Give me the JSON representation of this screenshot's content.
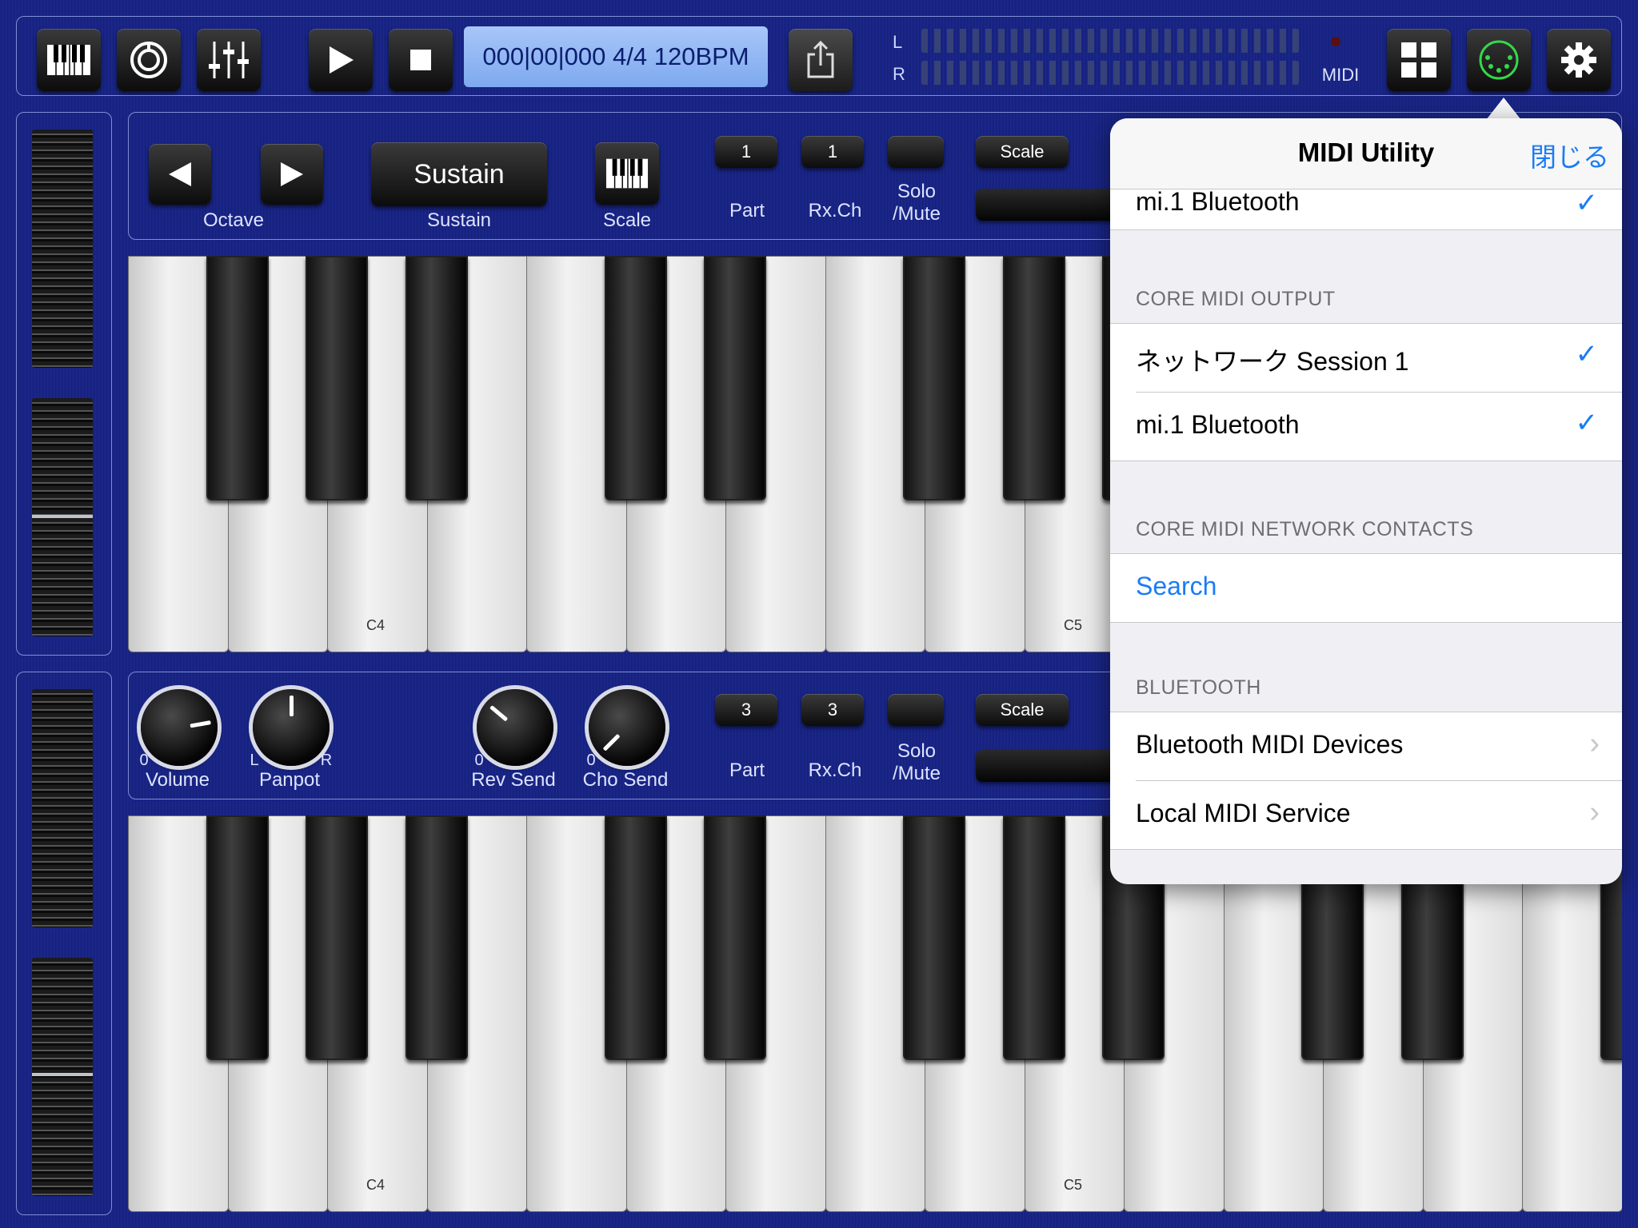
{
  "toolbar": {
    "transport_display": "000|00|000 4/4 120BPM",
    "meter_left": "L",
    "meter_right": "R",
    "midi_label": "MIDI"
  },
  "part1": {
    "octave_label": "Octave",
    "sustain_button": "Sustain",
    "sustain_label": "Sustain",
    "scale_label": "Scale",
    "part_value": "1",
    "part_label": "Part",
    "rxch_value": "1",
    "rxch_label": "Rx.Ch",
    "solo_label_1": "Solo",
    "solo_label_2": "/Mute",
    "scale_button": "Scale",
    "key_c4": "C4",
    "key_c5": "C5"
  },
  "part2": {
    "volume_zero": "0",
    "volume_label": "Volume",
    "panpot_l": "L",
    "panpot_r": "R",
    "panpot_label": "Panpot",
    "rev_zero": "0",
    "rev_label": "Rev Send",
    "cho_zero": "0",
    "cho_label": "Cho Send",
    "part_value": "3",
    "part_label": "Part",
    "rxch_value": "3",
    "rxch_label": "Rx.Ch",
    "solo_label_1": "Solo",
    "solo_label_2": "/Mute",
    "scale_button": "Scale",
    "key_c4": "C4",
    "key_c5": "C5"
  },
  "popover": {
    "title": "MIDI Utility",
    "close": "閉じる",
    "input_partial": "mi.1 Bluetooth",
    "output_header": "CORE MIDI OUTPUT",
    "output_items": [
      "ネットワーク Session 1",
      "mi.1 Bluetooth"
    ],
    "network_header": "CORE MIDI NETWORK CONTACTS",
    "search": "Search",
    "bluetooth_header": "BLUETOOTH",
    "bluetooth_items": [
      "Bluetooth MIDI Devices",
      "Local MIDI Service"
    ],
    "check": "✓",
    "chevron": "›"
  },
  "colors": {
    "accent": "#1a7cf5",
    "background": "#1a2586",
    "display": "#8fb5f3"
  }
}
